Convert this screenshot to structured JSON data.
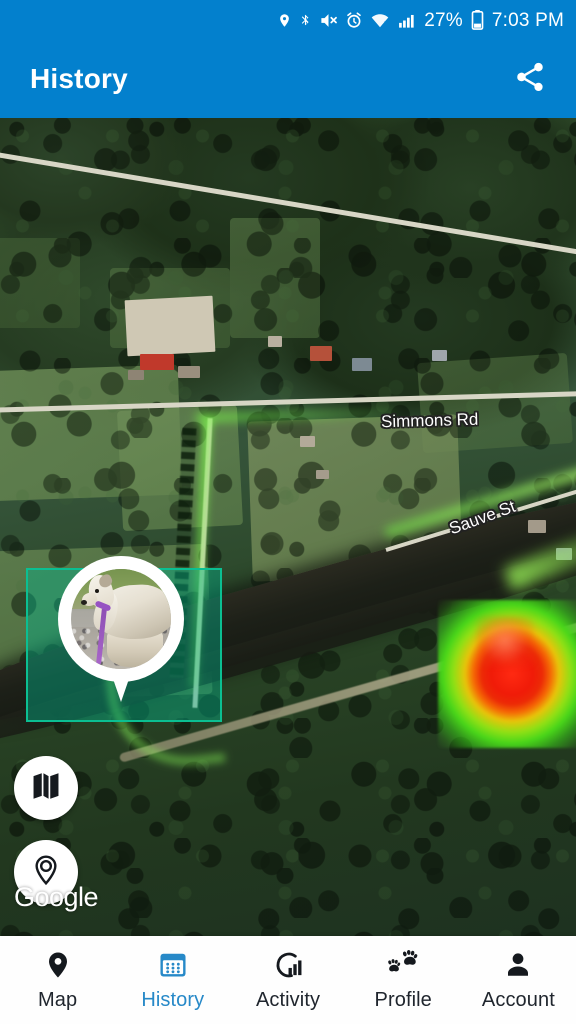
{
  "status_bar": {
    "icons": [
      "location-pin-icon",
      "bluetooth-icon",
      "mute-icon",
      "alarm-icon",
      "wifi-icon",
      "signal-bars-icon"
    ],
    "battery_percent": "27%",
    "battery_icon": "battery-icon",
    "time": "7:03 PM"
  },
  "app_bar": {
    "title": "History",
    "share_icon": "share-icon",
    "background_color": "#0380CD"
  },
  "map": {
    "road_labels": [
      {
        "name": "Simmons Rd"
      },
      {
        "name": "Sauve St"
      }
    ],
    "watermark": "Google",
    "controls": [
      {
        "name": "map-layers-button",
        "icon": "map-layers-icon"
      },
      {
        "name": "my-location-button",
        "icon": "my-location-icon"
      }
    ],
    "marker": {
      "type": "pet-photo-pin",
      "alt": "dog-photo"
    },
    "geofence": {
      "fill_color": "#00b48c",
      "border_color": "#0bbf92"
    },
    "heatmap": {
      "hot_color": "#ee1a08",
      "mid_color": "#e8c40a",
      "cool_color": "#49d61a"
    }
  },
  "bottom_nav": {
    "active_color": "#2789C8",
    "inactive_color": "#20262e",
    "items": [
      {
        "label": "Map",
        "icon": "map-pin-icon",
        "active": false
      },
      {
        "label": "History",
        "icon": "calendar-icon",
        "active": true
      },
      {
        "label": "Activity",
        "icon": "activity-icon",
        "active": false
      },
      {
        "label": "Profile",
        "icon": "paw-icon",
        "active": false
      },
      {
        "label": "Account",
        "icon": "person-icon",
        "active": false
      }
    ]
  }
}
